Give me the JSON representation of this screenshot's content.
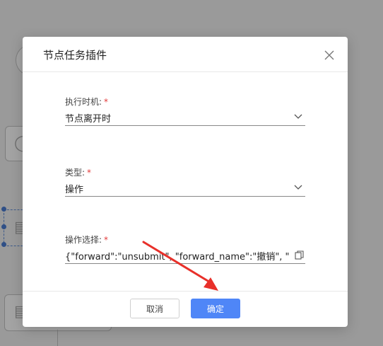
{
  "modal": {
    "title": "节点任务插件",
    "fields": [
      {
        "label": "执行时机:",
        "required": "*",
        "value": "节点离开时",
        "control": "select"
      },
      {
        "label": "类型:",
        "required": "*",
        "value": "操作",
        "control": "select"
      },
      {
        "label": "操作选择:",
        "required": "*",
        "value": "{\"forward\":\"unsubmit\", \"forward_name\":\"撤销\", \"",
        "control": "text-with-copy"
      }
    ],
    "footer": {
      "cancel_label": "取消",
      "ok_label": "确定"
    }
  },
  "colors": {
    "accent": "#4f86f7",
    "required": "#e23b3b",
    "annotation_arrow": "#e8302a",
    "overlay": "#9a9a9a"
  },
  "icons": [
    "close-icon",
    "chevron-down-icon",
    "copy-icon",
    "user-icon",
    "document-icon"
  ]
}
